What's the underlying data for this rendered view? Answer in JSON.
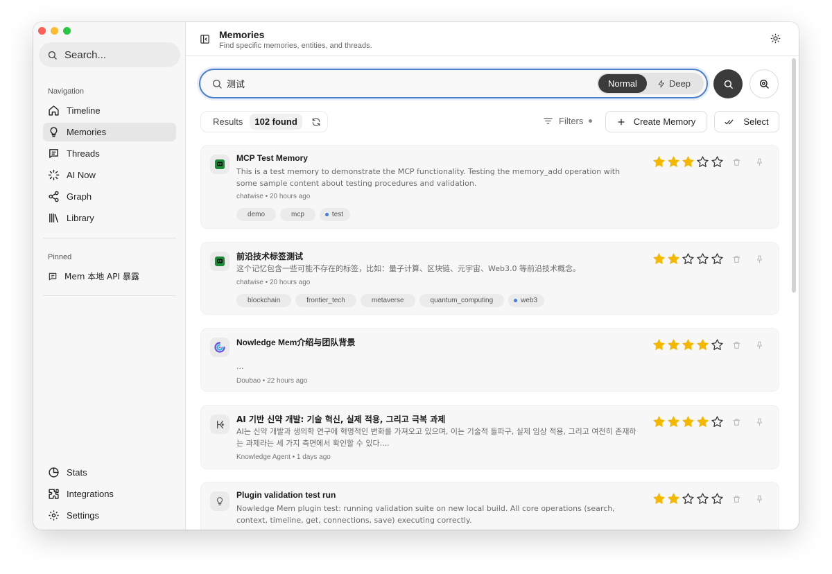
{
  "sidebar": {
    "search_label": "Search...",
    "navigation_title": "Navigation",
    "nav_items": [
      {
        "label": "Timeline",
        "icon": "home-icon"
      },
      {
        "label": "Memories",
        "icon": "lightbulb-icon",
        "active": true
      },
      {
        "label": "Threads",
        "icon": "message-square-icon"
      },
      {
        "label": "AI Now",
        "icon": "loader-icon"
      },
      {
        "label": "Graph",
        "icon": "share-icon"
      },
      {
        "label": "Library",
        "icon": "library-icon"
      }
    ],
    "pinned_title": "Pinned",
    "pinned_items": [
      {
        "label": "Mem 本地 API 暴露",
        "icon": "message-square-icon"
      }
    ],
    "bottom_items": [
      {
        "label": "Stats",
        "icon": "pie-chart-icon"
      },
      {
        "label": "Integrations",
        "icon": "puzzle-icon"
      },
      {
        "label": "Settings",
        "icon": "gear-icon"
      }
    ]
  },
  "header": {
    "title": "Memories",
    "subtitle": "Find specific memories, entities, and threads."
  },
  "search": {
    "query": "测试",
    "mode_normal": "Normal",
    "mode_deep": "Deep",
    "active_mode": "Normal"
  },
  "results": {
    "label": "Results",
    "count": "102 found",
    "filters_label": "Filters",
    "create_label": "Create Memory",
    "select_label": "Select"
  },
  "colors": {
    "accent_blue": "#4a7fd0",
    "star_gold": "#f5b800",
    "dark_button": "#3b3b3b",
    "tag_dot": "#3b7be4"
  },
  "memories": [
    {
      "title": "MCP Test Memory",
      "body": "This is a test memory to demonstrate the MCP functionality. Testing the memory_add operation with some sample content about testing procedures and validation.",
      "meta": "chatwise • 20 hours ago",
      "source_icon": "chatwise-icon",
      "rating": 3,
      "tags": [
        {
          "label": "demo",
          "dot": false
        },
        {
          "label": "mcp",
          "dot": false
        },
        {
          "label": "test",
          "dot": true
        }
      ]
    },
    {
      "title": "前沿技术标签测试",
      "body": "这个记忆包含一些可能不存在的标签，比如：量子计算、区块链、元宇宙、Web3.0 等前沿技术概念。",
      "meta": "chatwise • 20 hours ago",
      "source_icon": "chatwise-icon",
      "rating": 2,
      "tags": [
        {
          "label": "blockchain",
          "dot": false
        },
        {
          "label": "frontier_tech",
          "dot": false
        },
        {
          "label": "metaverse",
          "dot": false
        },
        {
          "label": "quantum_computing",
          "dot": false
        },
        {
          "label": "web3",
          "dot": true
        }
      ]
    },
    {
      "title": "Nowledge Mem介绍与团队背景",
      "body": "...",
      "meta": "Doubao • 22 hours ago",
      "source_icon": "doubao-icon",
      "rating": 4,
      "tags": []
    },
    {
      "title": "AI 기반 신약 개발: 기술 혁신, 실제 적용, 그리고 극복 과제",
      "body": "AI는 신약 개발과 생의학 연구에 혁명적인 변화를 가져오고 있으며, 이는 기술적 돌파구, 실제 임상 적용, 그리고 여전히 존재하는 과제라는 세 가지 측면에서 확인할 수 있다....",
      "meta": "Knowledge Agent • 1 days ago",
      "source_icon": "agent-icon",
      "rating": 4,
      "tags": []
    },
    {
      "title": "Plugin validation test run",
      "body": "Nowledge Mem plugin test: running validation suite on new local build. All core operations (search, context, timeline, get, connections, save) executing correctly.",
      "meta": "",
      "source_icon": "lightbulb-icon",
      "rating": 2,
      "tags": []
    }
  ]
}
